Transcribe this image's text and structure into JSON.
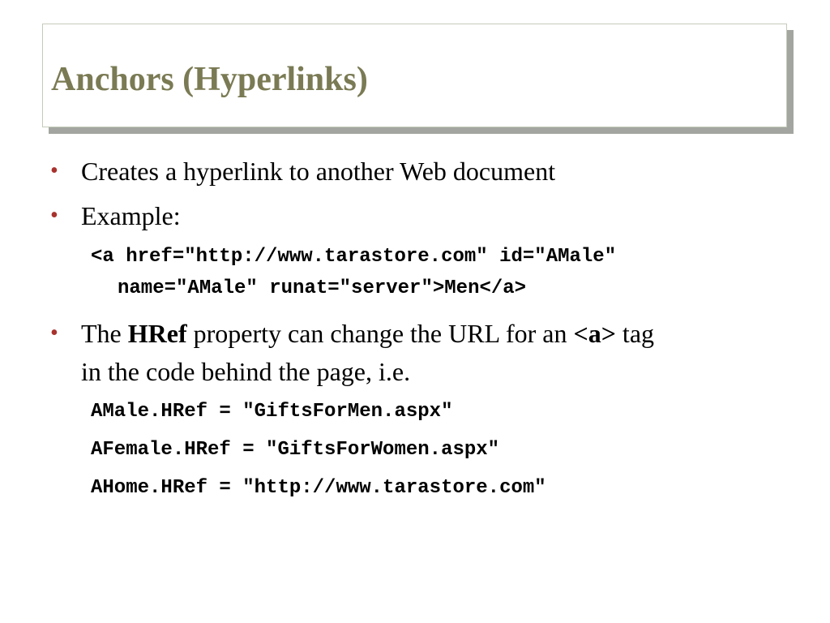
{
  "slide": {
    "title": "Anchors (Hyperlinks)",
    "bullets": {
      "b1": "Creates a hyperlink to another Web document",
      "b2": "Example:",
      "b3": {
        "part1": "The ",
        "bold1": "HRef",
        "part2": " property can change the URL for an ",
        "bold2": "<a>",
        "part3": " tag",
        "line2": "in the code behind the page, i.e."
      }
    },
    "example_code": {
      "line1": "<a href=\"http://www.tarastore.com\" id=\"AMale\"",
      "line2": "name=\"AMale\" runat=\"server\">Men</a>"
    },
    "code_lines": [
      "AMale.HRef = \"GiftsForMen.aspx\"",
      "AFemale.HRef = \"GiftsForWomen.aspx\"",
      "AHome.HRef = \"http://www.tarastore.com\""
    ],
    "colors": {
      "title": "#7a7a54",
      "bullet": "#a8322d",
      "title_shadow": "#a3a6a0"
    }
  }
}
